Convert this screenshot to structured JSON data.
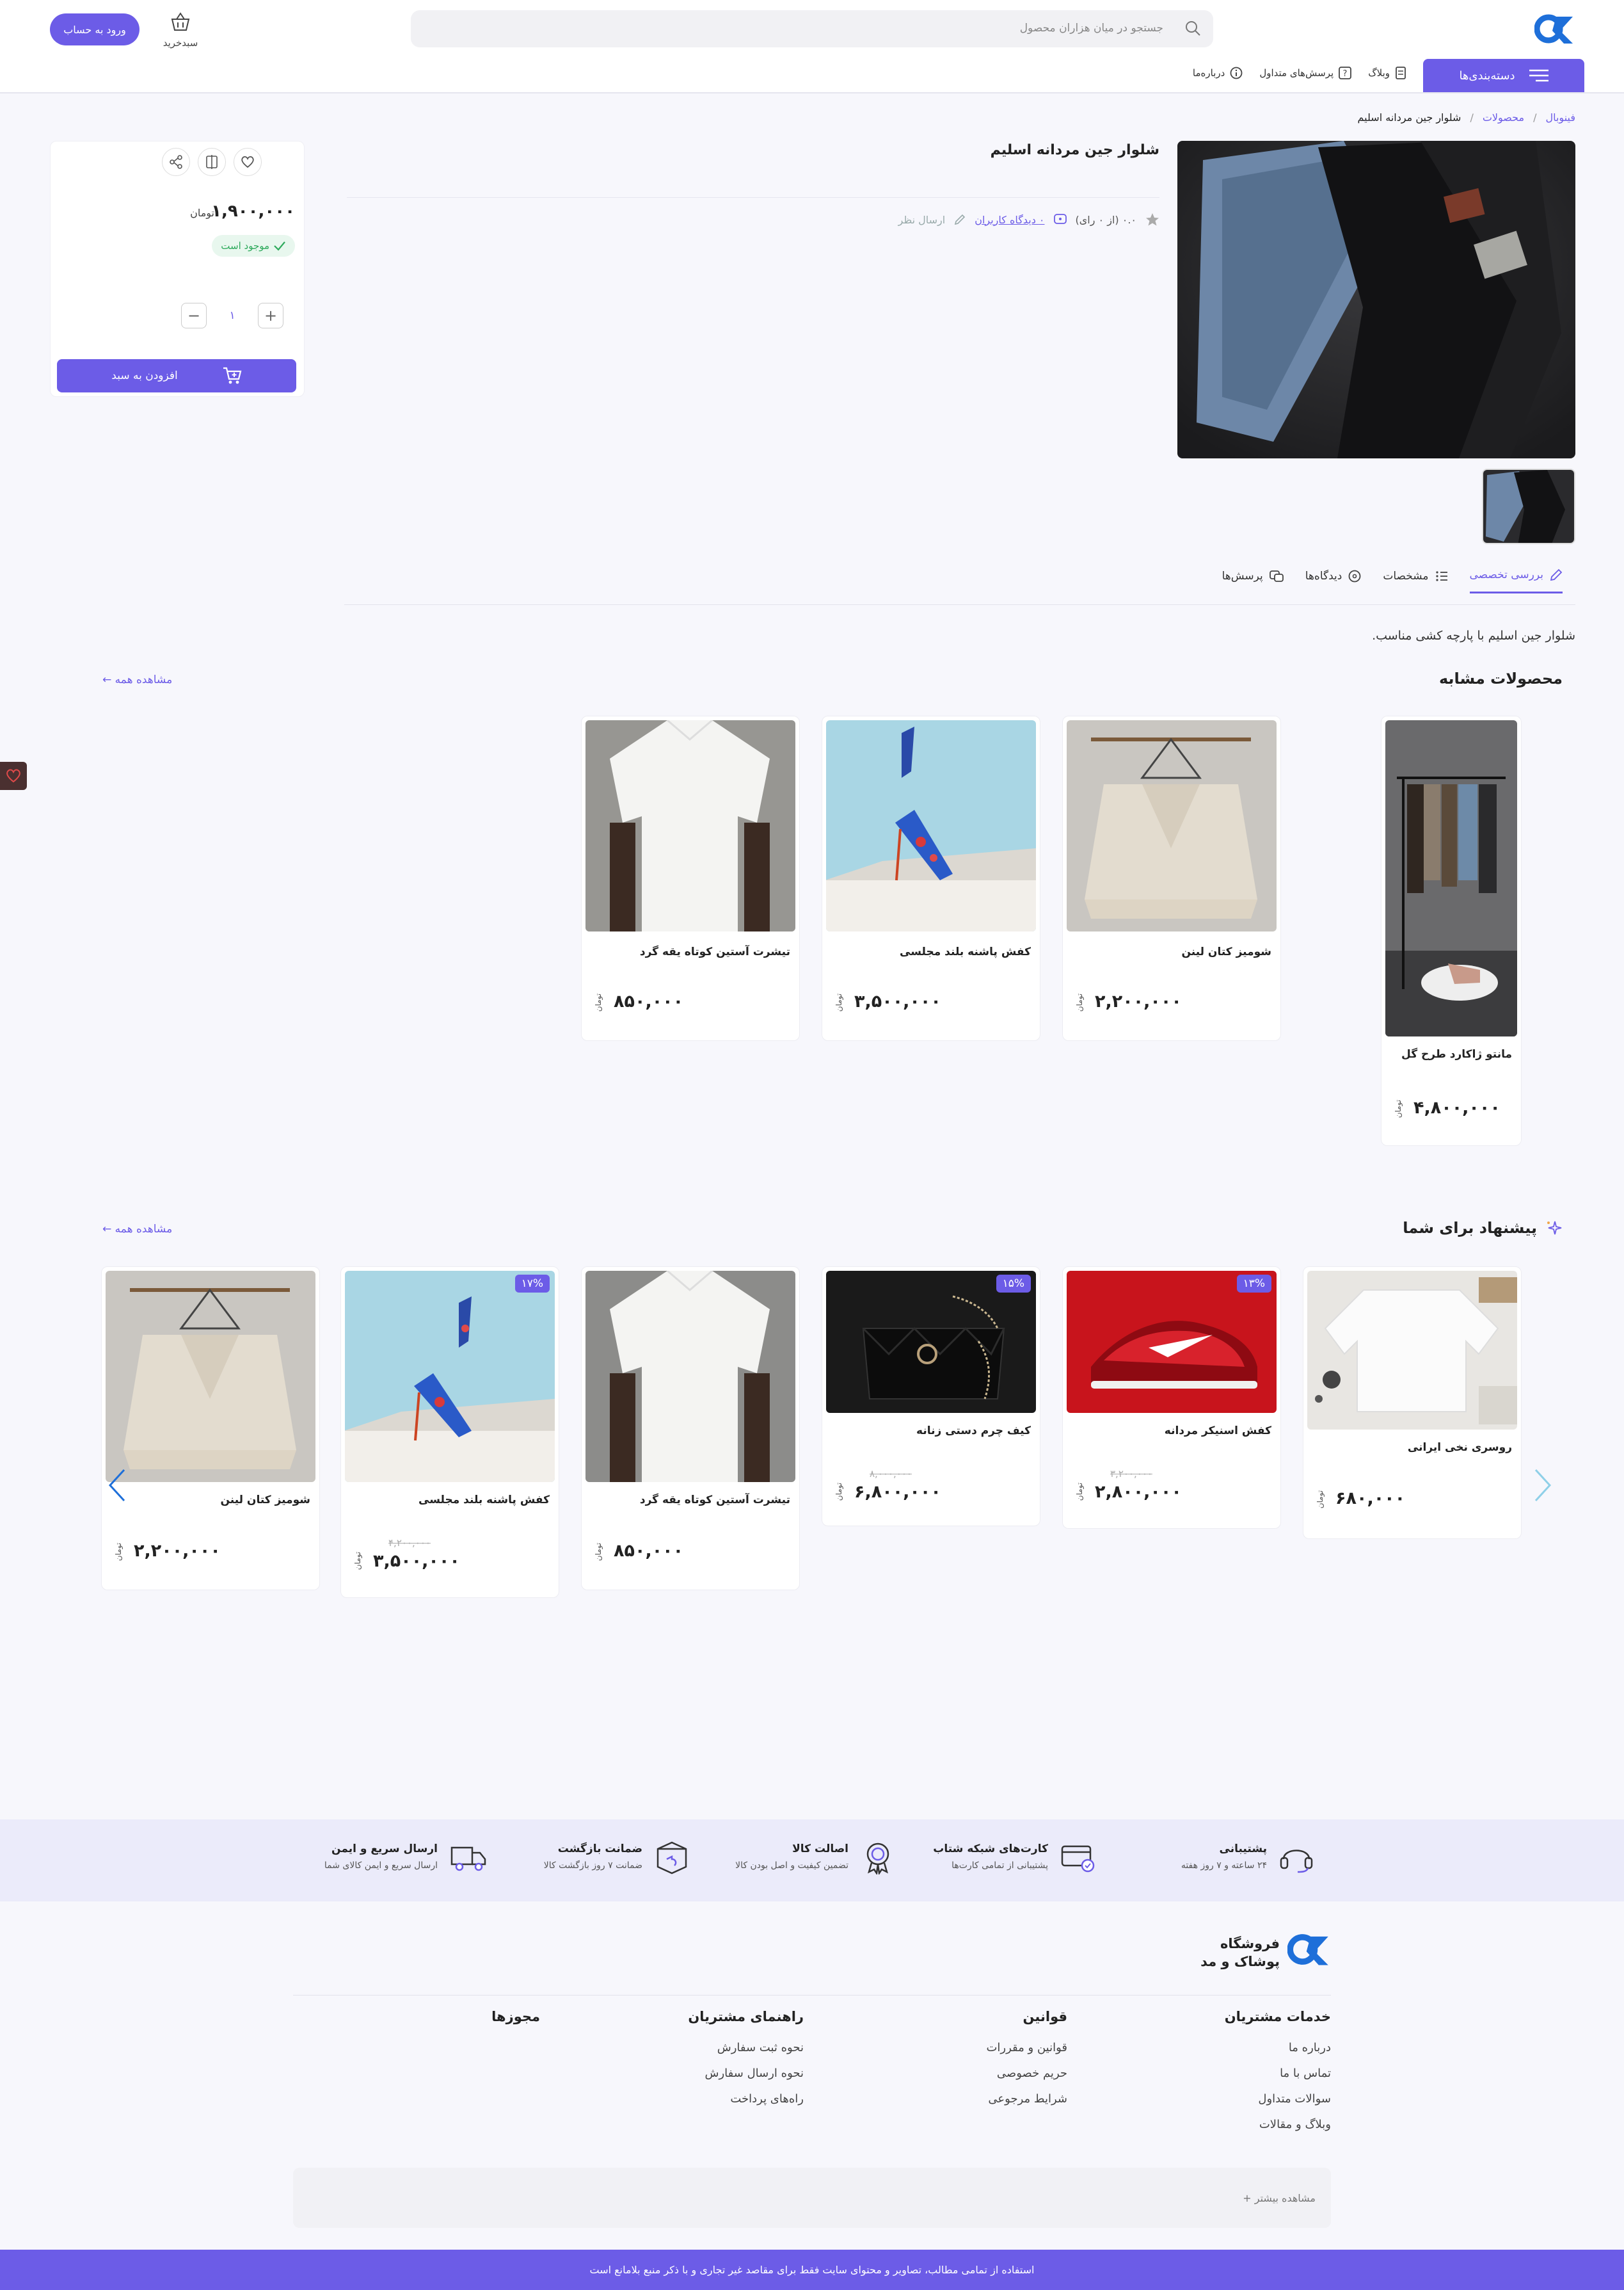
{
  "header": {
    "search_placeholder": "جستجو در میان هزاران محصول",
    "cart_label": "سبدخرید",
    "login_label": "ورود به حساب",
    "categories_label": "دسته‌بندی‌ها",
    "nav": [
      "وبلاگ",
      "پرسش‌های متداول",
      "درباره‌ما"
    ]
  },
  "breadcrumb": [
    "فینوبال",
    "محصولات",
    "شلوار جین مردانه اسلیم"
  ],
  "product": {
    "title": "شلوار جین مردانه اسلیم",
    "rating": "۰.۰ (از ۰ رای)",
    "reviews_link": "۰ دیدگاه کاربران",
    "write_review": "ارسال نظر",
    "price": "۱,۹۰۰,۰۰۰",
    "currency": "تومان",
    "stock": "موجود است",
    "quantity": "۱",
    "add_to_cart": "افزودن به سبد"
  },
  "tabs": [
    "بررسی تخصصی",
    "مشخصات",
    "دیدگاه‌ها",
    "پرسش‌ها"
  ],
  "description": "شلوار جین اسلیم با پارچه کشی مناسب.",
  "similar": {
    "title": "محصولات مشابه",
    "see_all": "مشاهده همه ←",
    "items": [
      {
        "name": "مانتو ژاکارد طرح گل",
        "price": "۴,۸۰۰,۰۰۰",
        "currency": "تومان"
      },
      {
        "name": "شومیز کتان لینن",
        "price": "۲,۲۰۰,۰۰۰",
        "currency": "تومان"
      },
      {
        "name": "کفش پاشنه بلند مجلسی",
        "price": "۳,۵۰۰,۰۰۰",
        "currency": "تومان"
      },
      {
        "name": "تیشرت آستین کوتاه یقه گرد",
        "price": "۸۵۰,۰۰۰",
        "currency": "تومان"
      }
    ]
  },
  "suggested": {
    "title": "پیشنهاد برای شما",
    "see_all": "مشاهده همه ←",
    "items": [
      {
        "name": "روسری نخی ایرانی",
        "price": "۶۸۰,۰۰۰",
        "currency": "تومان",
        "badge": "",
        "old": ""
      },
      {
        "name": "کفش اسنیکر مردانه",
        "price": "۲,۸۰۰,۰۰۰",
        "currency": "تومان",
        "badge": "۱۳%",
        "old": "۳,۲۰۰,۰۰۰"
      },
      {
        "name": "کیف چرم دستی زنانه",
        "price": "۶,۸۰۰,۰۰۰",
        "currency": "تومان",
        "badge": "۱۵%",
        "old": "۸,۰۰۰,۰۰۰"
      },
      {
        "name": "تیشرت آستین کوتاه یقه گرد",
        "price": "۸۵۰,۰۰۰",
        "currency": "تومان",
        "badge": "",
        "old": ""
      },
      {
        "name": "کفش پاشنه بلند مجلسی",
        "price": "۳,۵۰۰,۰۰۰",
        "currency": "تومان",
        "badge": "۱۷%",
        "old": "۴,۲۰۰,۰۰۰"
      },
      {
        "name": "شومیز کتان لینن",
        "price": "۲,۲۰۰,۰۰۰",
        "currency": "تومان",
        "badge": "",
        "old": ""
      }
    ]
  },
  "features": [
    {
      "title": "پشتیبانی",
      "sub": "۲۴ ساعته و ۷ روز هفته"
    },
    {
      "title": "کارت‌های شبکه شتاب",
      "sub": "پشتیبانی از تمامی کارت‌ها"
    },
    {
      "title": "اصالت کالا",
      "sub": "تضمین کیفیت و اصل بودن کالا"
    },
    {
      "title": "ضمانت بازگشت",
      "sub": "ضمانت ۷ روز بازگشت کالا"
    },
    {
      "title": "ارسال سریع و ایمن",
      "sub": "ارسال سریع و ایمن کالای شما"
    }
  ],
  "footer": {
    "store_name": "فروشگاه پوشاک و مد",
    "columns": [
      {
        "title": "خدمات مشتریان",
        "items": [
          "درباره ما",
          "تماس با ما",
          "سوالات متداول",
          "وبلاگ و مقالات"
        ]
      },
      {
        "title": "قوانین",
        "items": [
          "قوانین و مقررات",
          "حریم خصوصی",
          "شرایط مرجوعی"
        ]
      },
      {
        "title": "راهنمای مشتریان",
        "items": [
          "نحوه ثبت سفارش",
          "نحوه ارسال سفارش",
          "راه‌های پرداخت"
        ]
      },
      {
        "title": "مجوزها",
        "items": []
      }
    ],
    "more": "مشاهده بیشتر +",
    "copyright": "استفاده از تمامی مطالب، تصاویر و محتوای سایت فقط برای مقاصد غیر تجاری و با ذکر منبع بلامانع است"
  },
  "colors": {
    "accent": "#6c5ce7",
    "success": "#2eaa5c",
    "logo": "#1e6fd9"
  }
}
